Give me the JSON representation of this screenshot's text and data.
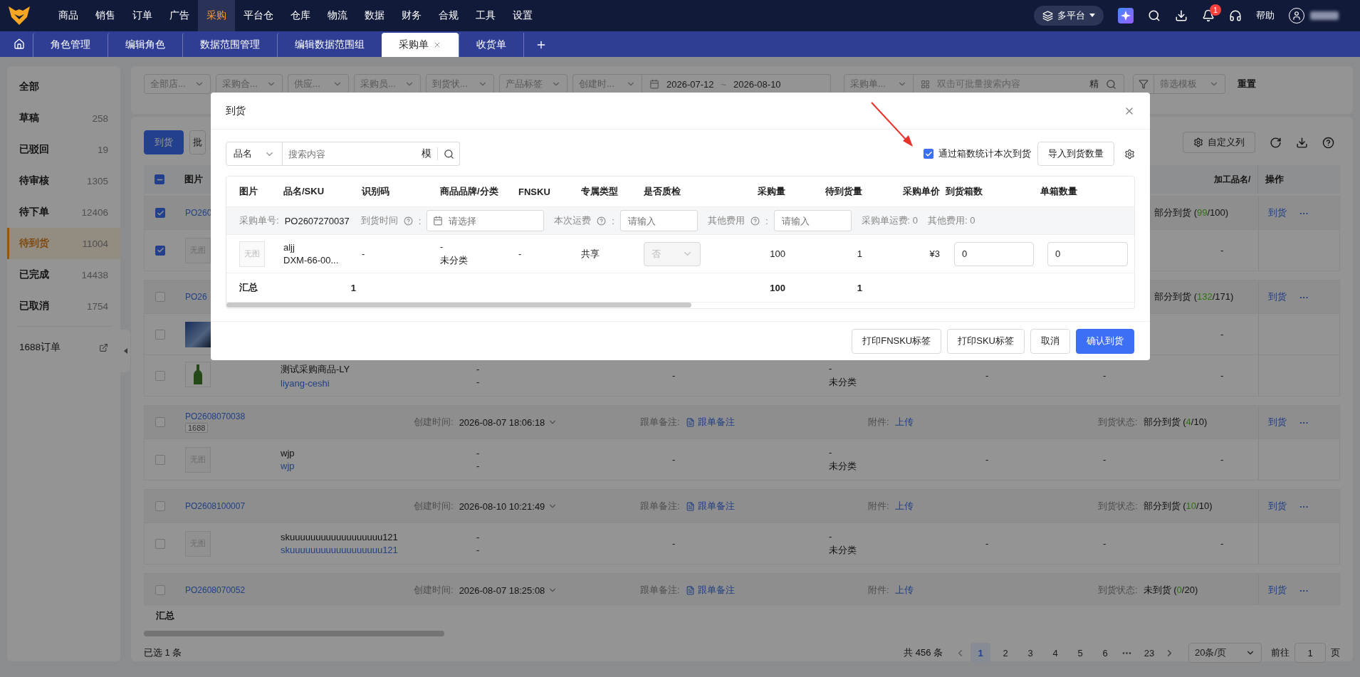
{
  "top_nav": {
    "items": [
      {
        "label": "商品",
        "selected": false
      },
      {
        "label": "销售",
        "selected": false
      },
      {
        "label": "订单",
        "selected": false
      },
      {
        "label": "广告",
        "selected": false
      },
      {
        "label": "采购",
        "selected": true
      },
      {
        "label": "平台仓",
        "selected": false
      },
      {
        "label": "仓库",
        "selected": false
      },
      {
        "label": "物流",
        "selected": false
      },
      {
        "label": "数据",
        "selected": false
      },
      {
        "label": "财务",
        "selected": false
      },
      {
        "label": "合规",
        "selected": false
      },
      {
        "label": "工具",
        "selected": false
      },
      {
        "label": "设置",
        "selected": false
      }
    ],
    "platform": "多平台",
    "notifications": "1",
    "help": "帮助"
  },
  "tabs": [
    {
      "label": "角色管理",
      "selected": false
    },
    {
      "label": "编辑角色",
      "selected": false
    },
    {
      "label": "数据范围管理",
      "selected": false
    },
    {
      "label": "编辑数据范围组",
      "selected": false
    },
    {
      "label": "采购单",
      "selected": true,
      "closable": true
    },
    {
      "label": "收货单",
      "selected": false
    }
  ],
  "sidebar": {
    "items": [
      {
        "label": "全部",
        "selected": false
      },
      {
        "label": "草稿",
        "count": "258",
        "selected": false
      },
      {
        "label": "已驳回",
        "count": "19",
        "selected": false
      },
      {
        "label": "待审核",
        "count": "1305",
        "selected": false
      },
      {
        "label": "待下单",
        "count": "12406",
        "selected": false
      },
      {
        "label": "待到货",
        "count": "11004",
        "selected": true
      },
      {
        "label": "已完成",
        "count": "14438",
        "selected": false
      },
      {
        "label": "已取消",
        "count": "1754",
        "selected": false
      }
    ],
    "external": "1688订单"
  },
  "filters": {
    "selects": [
      "全部店...",
      "采购合...",
      "供应...",
      "采购员...",
      "到货状...",
      "产品标签"
    ],
    "date_field": "创建时...",
    "date_start": "2026-07-12",
    "date_separator": "~",
    "date_end": "2026-08-10",
    "search_field": "采购单...",
    "search_placeholder": "双击可批量搜索内容",
    "search_mode": "精",
    "template_placeholder": "筛选模板",
    "reset": "重置"
  },
  "toolbar": {
    "primary": "到货",
    "secondary": "批",
    "custom_columns": "自定义列"
  },
  "table": {
    "header": {
      "indeterminate": true,
      "image": "图片",
      "process_name": "加工品名/",
      "actions": "操作"
    },
    "orders": [
      {
        "checked": true,
        "po": "PO260",
        "status": "部分到货",
        "progress_open": "(",
        "progress_done": "99",
        "progress_rest": "/100)",
        "action": "到货",
        "more": "···",
        "products": [
          {
            "checked": true,
            "kind": "blank",
            "image_text": "无图",
            "column_9": [
              "-"
            ]
          }
        ]
      },
      {
        "checked": false,
        "po": "PO26",
        "status": "部分到货",
        "progress_open": "(",
        "progress_done": "132",
        "progress_rest": "/171)",
        "action": "到货",
        "more": "···",
        "products": [
          {
            "checked": false,
            "kind": "photo",
            "column_9": [
              "-"
            ]
          },
          {
            "checked": false,
            "kind": "bottle",
            "name": "测试采购商品-LY",
            "sku": "liyang-ceshi",
            "column_4": [
              "-",
              "-"
            ],
            "column_5": [
              "-"
            ],
            "column_6": [
              "-",
              "未分类"
            ],
            "column_7": [
              "-"
            ],
            "column_8": [
              "-"
            ],
            "column_9": [
              "-"
            ]
          }
        ]
      },
      {
        "checked": false,
        "po": "PO2608070038",
        "tag": "1688",
        "created_label": "创建时间:",
        "created": "2026-08-07 18:06:18",
        "note_label": "跟单备注:",
        "note": "跟单备注",
        "attachment_label": "附件:",
        "attachment": "上传",
        "status_label": "到货状态:",
        "status": "部分到货",
        "progress_open": "(",
        "progress_done": "4",
        "progress_rest": "/10)",
        "action": "到货",
        "more": "···",
        "products": [
          {
            "checked": false,
            "kind": "blank",
            "image_text": "无图",
            "name": "wjp",
            "sku": "wjp",
            "column_4": [
              "-",
              "-"
            ],
            "column_5": [
              "-"
            ],
            "column_6": [
              "-",
              "未分类"
            ],
            "column_7": [
              "-"
            ],
            "column_8": [
              "-"
            ],
            "column_9": [
              "-"
            ]
          }
        ]
      },
      {
        "checked": false,
        "po": "PO2608100007",
        "created_label": "创建时间:",
        "created": "2026-08-10 10:21:49",
        "note_label": "跟单备注:",
        "note": "跟单备注",
        "attachment_label": "附件:",
        "attachment": "上传",
        "status_label": "到货状态:",
        "status": "部分到货",
        "progress_open": "(",
        "progress_done": "10",
        "progress_rest": "/10)",
        "action": "到货",
        "more": "···",
        "products": [
          {
            "checked": false,
            "kind": "blank",
            "image_text": "无图",
            "name": "skuuuuuuuuuuuuuuuuuu121",
            "sku": "skuuuuuuuuuuuuuuuuuu121",
            "column_4": [
              "-",
              "-"
            ],
            "column_5": [
              "-"
            ],
            "column_6": [
              "-",
              "未分类"
            ],
            "column_7": [
              "-"
            ],
            "column_8": [
              "-"
            ],
            "column_9": [
              "-"
            ]
          }
        ]
      },
      {
        "checked": false,
        "po": "PO2608070052",
        "created_label": "创建时间:",
        "created": "2026-08-07 18:25:08",
        "note_label": "跟单备注:",
        "note": "跟单备注",
        "attachment_label": "附件:",
        "attachment": "上传",
        "status_label": "到货状态:",
        "status": "未到货",
        "progress_open": "(",
        "progress_done": "0",
        "progress_rest": "/20)",
        "action": "到货",
        "more": "···"
      }
    ],
    "summary": "汇总"
  },
  "footer": {
    "selected_text": "已选 1 条",
    "total": "共 456 条",
    "pages": [
      {
        "label": "1",
        "selected": true
      },
      {
        "label": "2",
        "selected": false
      },
      {
        "label": "3",
        "selected": false
      },
      {
        "label": "4",
        "selected": false
      },
      {
        "label": "5",
        "selected": false
      },
      {
        "label": "6",
        "selected": false
      },
      {
        "label": "•••",
        "kind": "ellipsis"
      },
      {
        "label": "23",
        "selected": false
      }
    ],
    "page_size": "20条/页",
    "goto_label": "前往",
    "goto_value": "1",
    "goto_suffix": "页"
  },
  "dialog": {
    "title": "到货",
    "search_field": "品名",
    "search_placeholder": "搜索内容",
    "search_mode": "模",
    "box_count_option": {
      "label": "通过箱数统计本次到货",
      "checked": true
    },
    "import_button": "导入到货数量",
    "columns": [
      {
        "label": "图片",
        "kind": "text"
      },
      {
        "label": "品名/SKU",
        "kind": "text"
      },
      {
        "label": "识别码",
        "kind": "text"
      },
      {
        "label": "商品品牌/分类",
        "kind": "text"
      },
      {
        "label": "FNSKU",
        "kind": "text"
      },
      {
        "label": "专属类型",
        "kind": "text"
      },
      {
        "label": "是否质检",
        "kind": "text"
      },
      {
        "label": "采购量",
        "kind": "number"
      },
      {
        "label": "待到货量",
        "kind": "number"
      },
      {
        "label": "采购单价",
        "kind": "number"
      },
      {
        "label": "到货箱数",
        "kind": "text"
      },
      {
        "label": "单箱数量",
        "kind": "text"
      }
    ],
    "order_row": {
      "po_label": "采购单号:",
      "po": "PO2607270037",
      "arrival_label": "到货时间",
      "arrival_colon": ":",
      "arrival_placeholder": "请选择",
      "freight_label": "本次运费",
      "freight_colon": ":",
      "freight_placeholder": "请输入",
      "other_fee_label": "其他费用",
      "other_fee_colon": ":",
      "other_fee_placeholder": "请输入",
      "order_freight": "采购单运费: 0",
      "order_other_fee": "其他费用: 0"
    },
    "items": [
      {
        "image_text": "无图",
        "name": "aljj",
        "sku": "DXM-66-00...",
        "barcode": "-",
        "brand": "-",
        "category": "未分类",
        "fnsku": "-",
        "exclusive_type": "共享",
        "quality_check": "否",
        "quality_check_disabled": true,
        "purchase_qty": "100",
        "pending_qty": "1",
        "unit_price": "¥3",
        "box_count": "0",
        "per_box_qty": "0"
      }
    ],
    "summary": {
      "label": "汇总",
      "sku_count": "1",
      "purchase_qty": "100",
      "pending_qty": "1"
    },
    "buttons": [
      {
        "label": "打印FNSKU标签",
        "kind": "default"
      },
      {
        "label": "打印SKU标签",
        "kind": "default"
      },
      {
        "label": "取消",
        "kind": "default"
      },
      {
        "label": "确认到货",
        "kind": "primary"
      }
    ]
  }
}
